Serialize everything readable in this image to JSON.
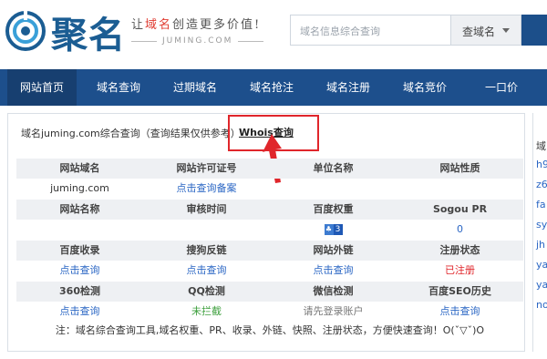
{
  "header": {
    "logo_text": "聚名",
    "slogan_prefix": "让",
    "slogan_highlight": "域名",
    "slogan_suffix": "创造更多价值!",
    "sub_url": "JUMING.COM",
    "search_placeholder": "域名信息综合查询",
    "search_select": "查域名",
    "colors": {
      "brand": "#1d4f8c",
      "accent": "#e03c31"
    }
  },
  "nav": {
    "items": [
      "网站首页",
      "域名查询",
      "过期域名",
      "域名抢注",
      "域名注册",
      "域名竞价",
      "一口价"
    ]
  },
  "panel": {
    "title": "域名juming.com综合查询（查询结果仅供参考）",
    "whois_link": "Whois查询",
    "rows": [
      {
        "type": "head",
        "cells": [
          "网站域名",
          "网站许可证号",
          "单位名称",
          "网站性质"
        ]
      },
      {
        "type": "data",
        "cells": [
          "juming.com",
          "点击查询备案",
          "",
          ""
        ]
      },
      {
        "type": "head",
        "cells": [
          "网站名称",
          "审核时间",
          "百度权重",
          "Sogou PR"
        ]
      },
      {
        "type": "data",
        "cells": [
          "",
          "",
          "3",
          "0"
        ]
      },
      {
        "type": "head",
        "cells": [
          "百度收录",
          "搜狗反链",
          "网站外链",
          "注册状态"
        ]
      },
      {
        "type": "data",
        "cells": [
          "点击查询",
          "点击查询",
          "点击查询",
          "已注册"
        ]
      },
      {
        "type": "head",
        "cells": [
          "360检测",
          "QQ检测",
          "微信检测",
          "百度SEO历史"
        ]
      },
      {
        "type": "data",
        "cells": [
          "点击查询",
          "未拦截",
          "请先登录账户",
          "点击查询"
        ]
      }
    ],
    "note": "注：域名综合查询工具,域名权重、PR、收录、外链、快照、注册状态，方便快速查询！O(ˇ▽ˇ)O",
    "highlight_color": "#e0262b"
  },
  "sidebar": {
    "items": [
      "域",
      "h9",
      "z6",
      "fa",
      "sy",
      "jh",
      "ya",
      "ya",
      "no"
    ]
  }
}
